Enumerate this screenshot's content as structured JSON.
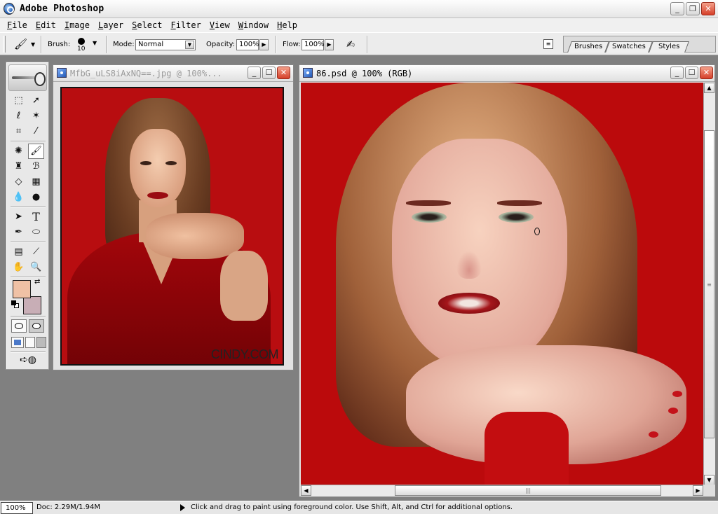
{
  "app": {
    "title": "Adobe Photoshop"
  },
  "menu": [
    "File",
    "Edit",
    "Image",
    "Layer",
    "Select",
    "Filter",
    "View",
    "Window",
    "Help"
  ],
  "options": {
    "brush_label": "Brush:",
    "brush_size": "10",
    "mode_label": "Mode:",
    "mode_value": "Normal",
    "opacity_label": "Opacity:",
    "opacity_value": "100%",
    "flow_label": "Flow:",
    "flow_value": "100%"
  },
  "palette_well": {
    "tabs": [
      "Brushes",
      "Swatches",
      "Styles"
    ]
  },
  "colors": {
    "foreground": "#efc1a5",
    "background": "#c8aeb6",
    "accent": "#b80d10"
  },
  "doc1": {
    "title": "MfbG_uLS8iAxNQ==.jpg @ 100%...",
    "watermark": "CINDY.COM"
  },
  "doc2": {
    "title": "86.psd @ 100% (RGB)"
  },
  "status": {
    "zoom": "100%",
    "doc_size": "Doc: 2.29M/1.94M",
    "hint": "Click and drag to paint using foreground color.  Use Shift, Alt, and Ctrl for additional options."
  }
}
